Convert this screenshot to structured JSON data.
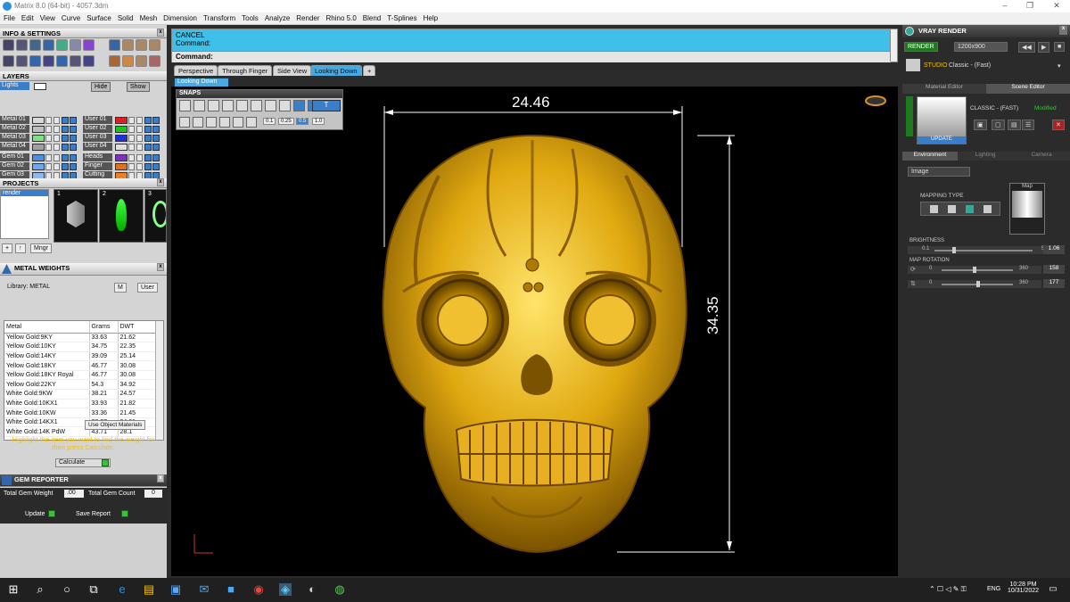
{
  "window": {
    "title": "Matrix 8.0 (64-bit) - 4057.3dm"
  },
  "menu": [
    "File",
    "Edit",
    "View",
    "Curve",
    "Surface",
    "Solid",
    "Mesh",
    "Dimension",
    "Transform",
    "Tools",
    "Analyze",
    "Render",
    "Rhino 5.0",
    "Blend",
    "T-Splines",
    "Help"
  ],
  "info_settings": {
    "title": "INFO & SETTINGS"
  },
  "layers": {
    "title": "LAYERS",
    "top_left": "Lights",
    "hide": "Hide",
    "show": "Show",
    "left": [
      {
        "name": "Metal 01",
        "color": "#d8d8d8"
      },
      {
        "name": "Metal 02",
        "color": "#bfbfbf"
      },
      {
        "name": "Metal 03",
        "color": "#7fe07f"
      },
      {
        "name": "Metal 04",
        "color": "#a0a0a0"
      },
      {
        "name": "Gem 01",
        "color": "#4a8fe0"
      },
      {
        "name": "Gem 02",
        "color": "#6aa8f0"
      },
      {
        "name": "Gem 03",
        "color": "#8ab8f0"
      },
      {
        "name": "Gem 04",
        "color": "#b0d0f0"
      }
    ],
    "right": [
      {
        "name": "User 01",
        "color": "#e02020"
      },
      {
        "name": "User 02",
        "color": "#20c020"
      },
      {
        "name": "User 03",
        "color": "#2030e0"
      },
      {
        "name": "User 04",
        "color": "#e0e0e0"
      },
      {
        "name": "Heads",
        "color": "#8030c0"
      },
      {
        "name": "Finger",
        "color": "#e07020"
      },
      {
        "name": "Cutting",
        "color": "#f08020"
      },
      {
        "name": "Creation",
        "color": "#f09020"
      }
    ]
  },
  "projects": {
    "title": "PROJECTS",
    "item": "render",
    "thumbs": [
      "1",
      "2",
      "3"
    ],
    "mngr": "Mngr"
  },
  "metal_weights": {
    "title": "METAL WEIGHTS",
    "library": "Library: METAL",
    "tag_m": "M",
    "tag_user": "User",
    "headers": [
      "Metal",
      "Grams",
      "DWT"
    ],
    "rows": [
      [
        "Yellow Gold:9KY",
        "33.63",
        "21.62"
      ],
      [
        "Yellow Gold:10KY",
        "34.75",
        "22.35"
      ],
      [
        "Yellow Gold:14KY",
        "39.09",
        "25.14"
      ],
      [
        "Yellow Gold:18KY",
        "46.77",
        "30.08"
      ],
      [
        "Yellow Gold:18KY Royal",
        "46.77",
        "30.08"
      ],
      [
        "Yellow Gold:22KY",
        "54.3",
        "34.92"
      ],
      [
        "White Gold:9KW",
        "38.21",
        "24.57"
      ],
      [
        "White Gold:10KX1",
        "33.93",
        "21.82"
      ],
      [
        "White Gold:10KW",
        "33.36",
        "21.45"
      ],
      [
        "White Gold:14KX1",
        "38.27",
        "24.61"
      ],
      [
        "White Gold:14K PdW",
        "43.71",
        "28.1"
      ]
    ],
    "use_object": "Use Object Materials",
    "hint": "Highlight the item you want to find the weight for then press Calculate.",
    "calculate": "Calculate"
  },
  "gem_reporter": {
    "title": "GEM REPORTER",
    "total_weight_label": "Total Gem Weight",
    "total_weight": ".00",
    "total_count_label": "Total Gem Count",
    "total_count": "0",
    "update": "Update",
    "save_report": "Save Report"
  },
  "command": {
    "cancel": "CANCEL",
    "prompt1": "Command:",
    "prompt2": "Command:"
  },
  "viewport_tabs": [
    "Perspective",
    "Through Finger",
    "Side View",
    "Looking Down"
  ],
  "active_view": "Looking Down",
  "snaps": {
    "title": "SNAPS",
    "values": [
      "0.1",
      "0.25",
      "0.5",
      "1.0"
    ]
  },
  "dimensions": {
    "width": "24.46",
    "height": "34.35"
  },
  "vray": {
    "title": "VRAY RENDER",
    "render": "RENDER",
    "resolution": "1200x900",
    "studio": "STUDIO",
    "preset": "Classic - (Fast)",
    "tab_material": "Material Editor",
    "tab_scene": "Scene Editor",
    "scene_name": "CLASSIC - (FAST)",
    "modified": "Modified",
    "update": "UPDATE",
    "sub_tabs": [
      "Environment",
      "Lighting",
      "Camera"
    ],
    "env_type": "Image",
    "mapping_type": "MAPPING TYPE",
    "map": "Map",
    "brightness": "BRIGHTNESS",
    "brightness_min": "0.1",
    "brightness_max": "5",
    "brightness_val": "1.06",
    "map_rotation": "MAP ROTATION",
    "rot1_min": "0",
    "rot1_max": "360",
    "rot1_val": "158",
    "rot2_min": "0",
    "rot2_max": "360",
    "rot2_val": "177"
  },
  "taskbar": {
    "lang": "ENG",
    "time": "10:28 PM",
    "date": "10/31/2022"
  }
}
